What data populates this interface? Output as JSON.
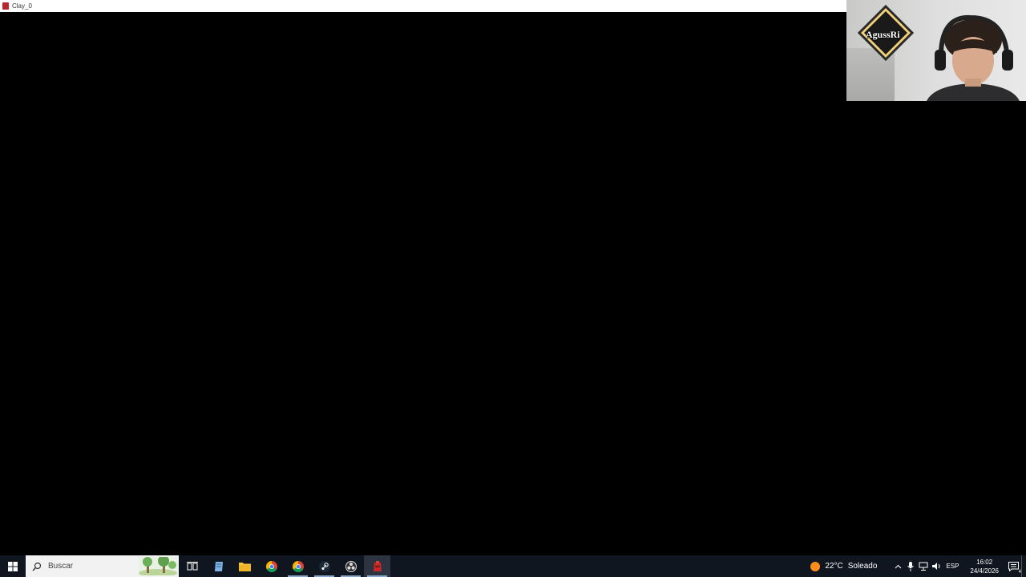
{
  "window": {
    "title": "Clay_0"
  },
  "webcam": {
    "badge_text": "AgussRi"
  },
  "taskbar": {
    "search_placeholder": "Buscar",
    "apps": [
      {
        "name": "task-view",
        "icon": "task-view-icon"
      },
      {
        "name": "notepad",
        "icon": "notepad-icon"
      },
      {
        "name": "file-explorer",
        "icon": "folder-icon"
      },
      {
        "name": "chrome",
        "icon": "chrome-icon"
      },
      {
        "name": "chrome-2",
        "icon": "chrome-icon"
      },
      {
        "name": "steam",
        "icon": "steam-icon"
      },
      {
        "name": "obs",
        "icon": "obs-icon"
      },
      {
        "name": "clay-game",
        "icon": "clay-app-icon"
      }
    ],
    "weather": {
      "temperature": "22°C",
      "condition": "Soleado"
    },
    "language": "ESP",
    "time": "16:02",
    "date": "24/4/2026",
    "notification_count": "4"
  },
  "colors": {
    "taskbar_bg": "#0f1620",
    "accent": "#b8262a",
    "weather_sun": "#ff8c1a"
  }
}
